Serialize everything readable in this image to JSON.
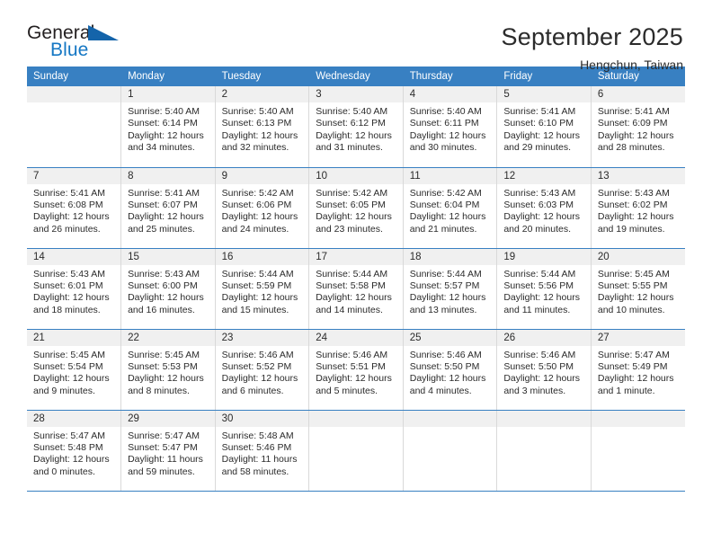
{
  "brand": {
    "name_top": "General",
    "name_bottom": "Blue",
    "triangle_color": "#1464aa",
    "blue_color": "#1577c4"
  },
  "header": {
    "title": "September 2025",
    "subtitle": "Hengchun, Taiwan"
  },
  "theme": {
    "header_bg": "#3880c2",
    "header_text": "#ffffff",
    "daynum_bg": "#f0f0f0",
    "row_border": "#3880c2",
    "cell_border": "#d9d9d9"
  },
  "weekdays": [
    "Sunday",
    "Monday",
    "Tuesday",
    "Wednesday",
    "Thursday",
    "Friday",
    "Saturday"
  ],
  "weeks": [
    [
      {
        "day": "",
        "lines": []
      },
      {
        "day": "1",
        "lines": [
          "Sunrise: 5:40 AM",
          "Sunset: 6:14 PM",
          "Daylight: 12 hours",
          "and 34 minutes."
        ]
      },
      {
        "day": "2",
        "lines": [
          "Sunrise: 5:40 AM",
          "Sunset: 6:13 PM",
          "Daylight: 12 hours",
          "and 32 minutes."
        ]
      },
      {
        "day": "3",
        "lines": [
          "Sunrise: 5:40 AM",
          "Sunset: 6:12 PM",
          "Daylight: 12 hours",
          "and 31 minutes."
        ]
      },
      {
        "day": "4",
        "lines": [
          "Sunrise: 5:40 AM",
          "Sunset: 6:11 PM",
          "Daylight: 12 hours",
          "and 30 minutes."
        ]
      },
      {
        "day": "5",
        "lines": [
          "Sunrise: 5:41 AM",
          "Sunset: 6:10 PM",
          "Daylight: 12 hours",
          "and 29 minutes."
        ]
      },
      {
        "day": "6",
        "lines": [
          "Sunrise: 5:41 AM",
          "Sunset: 6:09 PM",
          "Daylight: 12 hours",
          "and 28 minutes."
        ]
      }
    ],
    [
      {
        "day": "7",
        "lines": [
          "Sunrise: 5:41 AM",
          "Sunset: 6:08 PM",
          "Daylight: 12 hours",
          "and 26 minutes."
        ]
      },
      {
        "day": "8",
        "lines": [
          "Sunrise: 5:41 AM",
          "Sunset: 6:07 PM",
          "Daylight: 12 hours",
          "and 25 minutes."
        ]
      },
      {
        "day": "9",
        "lines": [
          "Sunrise: 5:42 AM",
          "Sunset: 6:06 PM",
          "Daylight: 12 hours",
          "and 24 minutes."
        ]
      },
      {
        "day": "10",
        "lines": [
          "Sunrise: 5:42 AM",
          "Sunset: 6:05 PM",
          "Daylight: 12 hours",
          "and 23 minutes."
        ]
      },
      {
        "day": "11",
        "lines": [
          "Sunrise: 5:42 AM",
          "Sunset: 6:04 PM",
          "Daylight: 12 hours",
          "and 21 minutes."
        ]
      },
      {
        "day": "12",
        "lines": [
          "Sunrise: 5:43 AM",
          "Sunset: 6:03 PM",
          "Daylight: 12 hours",
          "and 20 minutes."
        ]
      },
      {
        "day": "13",
        "lines": [
          "Sunrise: 5:43 AM",
          "Sunset: 6:02 PM",
          "Daylight: 12 hours",
          "and 19 minutes."
        ]
      }
    ],
    [
      {
        "day": "14",
        "lines": [
          "Sunrise: 5:43 AM",
          "Sunset: 6:01 PM",
          "Daylight: 12 hours",
          "and 18 minutes."
        ]
      },
      {
        "day": "15",
        "lines": [
          "Sunrise: 5:43 AM",
          "Sunset: 6:00 PM",
          "Daylight: 12 hours",
          "and 16 minutes."
        ]
      },
      {
        "day": "16",
        "lines": [
          "Sunrise: 5:44 AM",
          "Sunset: 5:59 PM",
          "Daylight: 12 hours",
          "and 15 minutes."
        ]
      },
      {
        "day": "17",
        "lines": [
          "Sunrise: 5:44 AM",
          "Sunset: 5:58 PM",
          "Daylight: 12 hours",
          "and 14 minutes."
        ]
      },
      {
        "day": "18",
        "lines": [
          "Sunrise: 5:44 AM",
          "Sunset: 5:57 PM",
          "Daylight: 12 hours",
          "and 13 minutes."
        ]
      },
      {
        "day": "19",
        "lines": [
          "Sunrise: 5:44 AM",
          "Sunset: 5:56 PM",
          "Daylight: 12 hours",
          "and 11 minutes."
        ]
      },
      {
        "day": "20",
        "lines": [
          "Sunrise: 5:45 AM",
          "Sunset: 5:55 PM",
          "Daylight: 12 hours",
          "and 10 minutes."
        ]
      }
    ],
    [
      {
        "day": "21",
        "lines": [
          "Sunrise: 5:45 AM",
          "Sunset: 5:54 PM",
          "Daylight: 12 hours",
          "and 9 minutes."
        ]
      },
      {
        "day": "22",
        "lines": [
          "Sunrise: 5:45 AM",
          "Sunset: 5:53 PM",
          "Daylight: 12 hours",
          "and 8 minutes."
        ]
      },
      {
        "day": "23",
        "lines": [
          "Sunrise: 5:46 AM",
          "Sunset: 5:52 PM",
          "Daylight: 12 hours",
          "and 6 minutes."
        ]
      },
      {
        "day": "24",
        "lines": [
          "Sunrise: 5:46 AM",
          "Sunset: 5:51 PM",
          "Daylight: 12 hours",
          "and 5 minutes."
        ]
      },
      {
        "day": "25",
        "lines": [
          "Sunrise: 5:46 AM",
          "Sunset: 5:50 PM",
          "Daylight: 12 hours",
          "and 4 minutes."
        ]
      },
      {
        "day": "26",
        "lines": [
          "Sunrise: 5:46 AM",
          "Sunset: 5:50 PM",
          "Daylight: 12 hours",
          "and 3 minutes."
        ]
      },
      {
        "day": "27",
        "lines": [
          "Sunrise: 5:47 AM",
          "Sunset: 5:49 PM",
          "Daylight: 12 hours",
          "and 1 minute."
        ]
      }
    ],
    [
      {
        "day": "28",
        "lines": [
          "Sunrise: 5:47 AM",
          "Sunset: 5:48 PM",
          "Daylight: 12 hours",
          "and 0 minutes."
        ]
      },
      {
        "day": "29",
        "lines": [
          "Sunrise: 5:47 AM",
          "Sunset: 5:47 PM",
          "Daylight: 11 hours",
          "and 59 minutes."
        ]
      },
      {
        "day": "30",
        "lines": [
          "Sunrise: 5:48 AM",
          "Sunset: 5:46 PM",
          "Daylight: 11 hours",
          "and 58 minutes."
        ]
      },
      {
        "day": "",
        "lines": []
      },
      {
        "day": "",
        "lines": []
      },
      {
        "day": "",
        "lines": []
      },
      {
        "day": "",
        "lines": []
      }
    ]
  ]
}
